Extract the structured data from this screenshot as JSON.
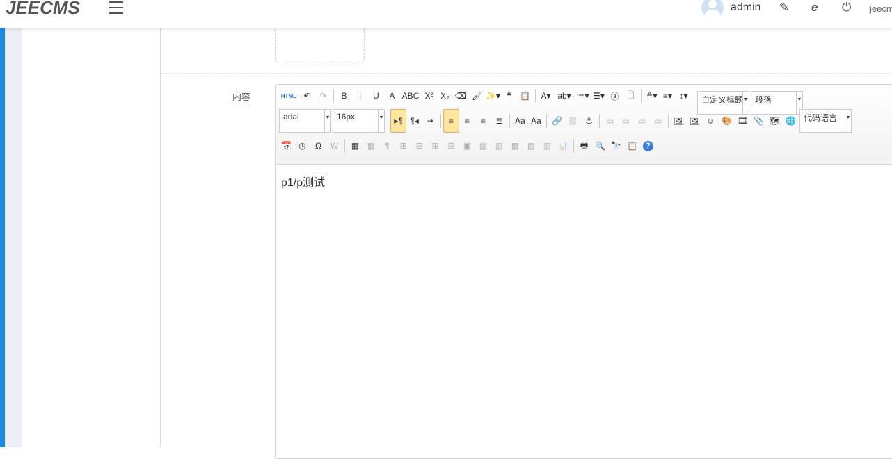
{
  "header": {
    "logo": "JEECMS",
    "username": "admin",
    "site": "jeecms"
  },
  "form": {
    "content_label": "内容"
  },
  "editor": {
    "font_family": "arial",
    "font_size": "16px",
    "custom_title": "自定义标题",
    "paragraph": "段落",
    "code_language": "代码语言",
    "content": "p1/p测试",
    "row1": [
      [
        "html",
        "HTML"
      ],
      [
        "undo",
        "↶"
      ],
      [
        "redo",
        "↷"
      ],
      [
        "sep"
      ],
      [
        "bold",
        "B"
      ],
      [
        "italic",
        "I"
      ],
      [
        "underline",
        "U"
      ],
      [
        "fontborder",
        "A"
      ],
      [
        "strikethrough",
        "ABC"
      ],
      [
        "superscript",
        "X²"
      ],
      [
        "subscript",
        "X₂"
      ],
      [
        "removeformat",
        "⌫"
      ],
      [
        "formatmatch",
        "🖌"
      ],
      [
        "autotypeset",
        "✨▾"
      ],
      [
        "blockquote",
        "❝"
      ],
      [
        "pasteplain",
        "📋"
      ],
      [
        "sep"
      ],
      [
        "forecolor",
        "A▾"
      ],
      [
        "backcolor",
        "ab▾"
      ],
      [
        "insertorderedlist",
        "≔▾"
      ],
      [
        "insertunorderedlist",
        "☰▾"
      ],
      [
        "selectall",
        "ⓐ"
      ],
      [
        "cleardoc",
        "🗋"
      ],
      [
        "sep"
      ],
      [
        "rowspacingtop",
        "≜▾"
      ],
      [
        "rowspacingbottom",
        "≡▾"
      ],
      [
        "lineheight",
        "↕▾"
      ],
      [
        "sep"
      ]
    ],
    "row2a": [
      [
        "directionalityltr",
        "▸¶"
      ],
      [
        "directionalityrtl",
        "¶◂"
      ],
      [
        "indent",
        "⇥"
      ],
      [
        "sep"
      ],
      [
        "justifyleft",
        "≡"
      ],
      [
        "justifycenter",
        "≡"
      ],
      [
        "justifyright",
        "≡"
      ],
      [
        "justifyjustify",
        "≣"
      ],
      [
        "sep"
      ],
      [
        "touppercase",
        "Aa"
      ],
      [
        "tolowercase",
        "Aa"
      ],
      [
        "sep"
      ],
      [
        "link",
        "🔗"
      ],
      [
        "unlink",
        "⛓"
      ],
      [
        "anchor",
        "⚓"
      ],
      [
        "sep"
      ],
      [
        "imagenone",
        "▭"
      ],
      [
        "imageleft",
        "▭"
      ],
      [
        "imageright",
        "▭"
      ],
      [
        "imagecenter",
        "▭"
      ],
      [
        "sep"
      ],
      [
        "simpleupload",
        "🖼"
      ],
      [
        "insertimage",
        "🖼"
      ],
      [
        "emotion",
        "☺"
      ],
      [
        "scrawl",
        "🎨"
      ],
      [
        "insertvideo",
        "🎞"
      ],
      [
        "attachment",
        "📎"
      ],
      [
        "map",
        "🗺"
      ],
      [
        "gmap",
        "🌐"
      ]
    ],
    "row3": [
      [
        "date",
        "📅"
      ],
      [
        "time",
        "◷"
      ],
      [
        "spechars",
        "Ω"
      ],
      [
        "wordimage",
        "W"
      ],
      [
        "sep"
      ],
      [
        "inserttable",
        "▦"
      ],
      [
        "deletetable",
        "▦"
      ],
      [
        "insertparagraphbeforetable",
        "¶"
      ],
      [
        "insertrow",
        "⊞"
      ],
      [
        "deleterow",
        "⊟"
      ],
      [
        "insertcol",
        "⊞"
      ],
      [
        "deletecol",
        "⊟"
      ],
      [
        "mergecells",
        "▣"
      ],
      [
        "mergeright",
        "▤"
      ],
      [
        "mergedown",
        "▥"
      ],
      [
        "splittocells",
        "▦"
      ],
      [
        "splittorows",
        "▤"
      ],
      [
        "splittocols",
        "▥"
      ],
      [
        "charts",
        "📊"
      ],
      [
        "sep"
      ],
      [
        "print",
        "🖶"
      ],
      [
        "preview",
        "🔍"
      ],
      [
        "searchreplace",
        "🔭"
      ],
      [
        "drafts",
        "📋"
      ],
      [
        "help",
        "?"
      ]
    ]
  }
}
